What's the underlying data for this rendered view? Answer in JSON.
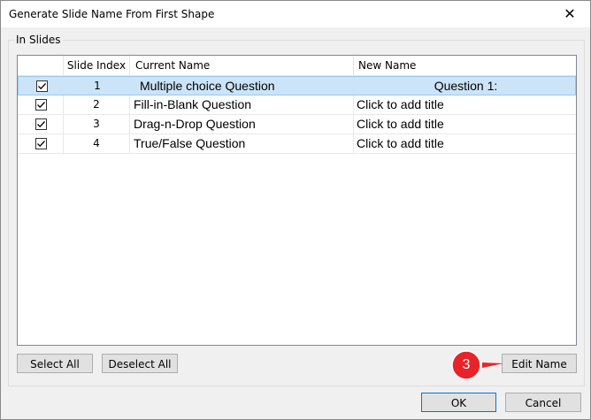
{
  "window": {
    "title": "Generate Slide Name From First Shape",
    "close_glyph": "✕"
  },
  "group": {
    "label": "In Slides"
  },
  "table": {
    "columns": [
      "",
      "Slide Index",
      "Current Name",
      "New Name"
    ],
    "rows": [
      {
        "checked": true,
        "index": "1",
        "current": "Multiple choice Question",
        "new": "Question 1:",
        "selected": true
      },
      {
        "checked": true,
        "index": "2",
        "current": "Fill-in-Blank Question",
        "new": "Click to add title",
        "selected": false
      },
      {
        "checked": true,
        "index": "3",
        "current": "Drag-n-Drop Question",
        "new": "Click to add title",
        "selected": false
      },
      {
        "checked": true,
        "index": "4",
        "current": "True/False Question",
        "new": "Click to add title",
        "selected": false
      }
    ]
  },
  "buttons": {
    "select_all": "Select All",
    "deselect_all": "Deselect All",
    "edit_name": "Edit Name",
    "ok": "OK",
    "cancel": "Cancel"
  },
  "callout": {
    "number": "3",
    "color": "#e8242a"
  },
  "icons": {
    "checkbox": "checkbox-checked-icon",
    "close": "close-icon"
  }
}
